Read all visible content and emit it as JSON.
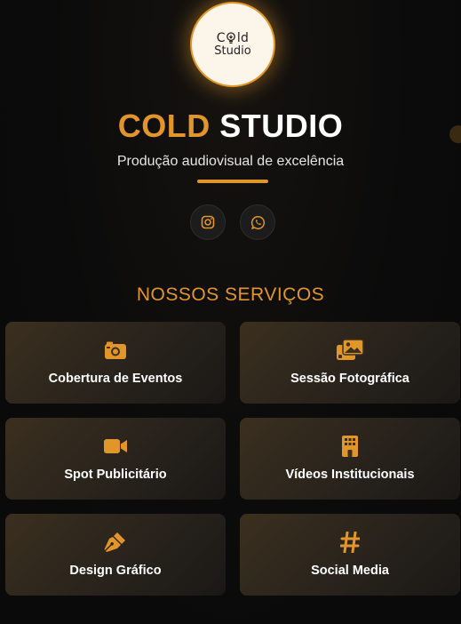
{
  "brand": {
    "logo_line1_pre": "C",
    "logo_line1_post": "ld",
    "logo_line2": "Studio",
    "title_accent": "COLD",
    "title_rest": "STUDIO",
    "subtitle": "Produção audiovisual de excelência",
    "accent_color": "#e2962a"
  },
  "social": [
    {
      "icon": "instagram-icon"
    },
    {
      "icon": "whatsapp-icon"
    }
  ],
  "services": {
    "title": "NOSSOS SERVIÇOS",
    "items": [
      {
        "label": "Cobertura de Eventos",
        "icon": "camera-icon"
      },
      {
        "label": "Sessão Fotográfica",
        "icon": "images-icon"
      },
      {
        "label": "Spot Publicitário",
        "icon": "video-icon"
      },
      {
        "label": "Vídeos Institucionais",
        "icon": "building-icon"
      },
      {
        "label": "Design Gráfico",
        "icon": "pen-nib-icon"
      },
      {
        "label": "Social Media",
        "icon": "hashtag-icon"
      }
    ]
  }
}
